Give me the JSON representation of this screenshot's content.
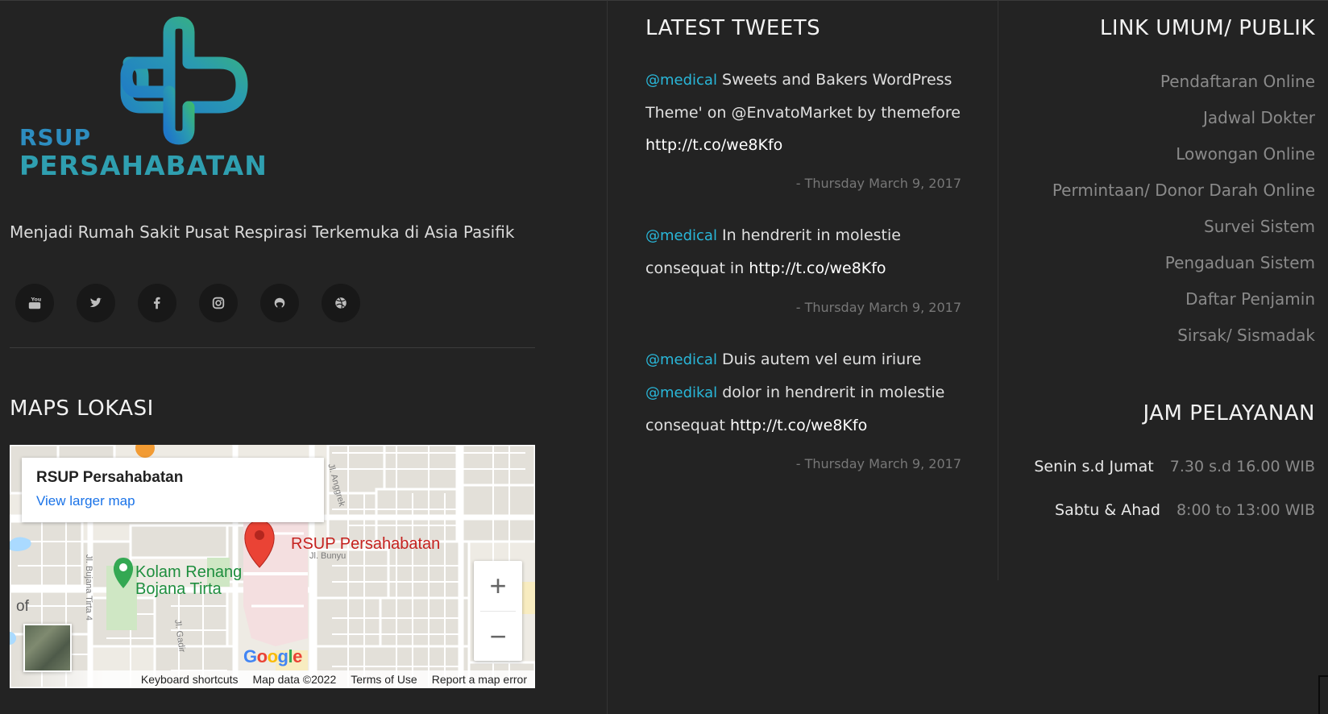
{
  "brand": {
    "logo_line1": "RSUP",
    "logo_line2": "PERSAHABATAN",
    "tagline": "Menjadi Rumah Sakit Pusat Respirasi Terkemuka di Asia Pasifik"
  },
  "socials": [
    {
      "icon": "youtube-icon"
    },
    {
      "icon": "twitter-icon"
    },
    {
      "icon": "facebook-icon"
    },
    {
      "icon": "instagram-icon"
    },
    {
      "icon": "github-icon"
    },
    {
      "icon": "dribbble-icon"
    }
  ],
  "maps": {
    "title": "MAPS LOKASI",
    "card_title": "RSUP Persahabatan",
    "card_link": "View larger map",
    "pin_label": "RSUP Persahabatan",
    "poi_label_1": "Kolam Renang",
    "poi_label_2": "Bojana Tirta",
    "street_1": "Jl. Anggrek",
    "street_2": "Jl. Bunyu",
    "street_3": "Jl. Bujana Tirta 4",
    "street_4": "Jl. Gadir",
    "edge_text": "of",
    "google": "Google",
    "zoom_in": "+",
    "zoom_out": "−",
    "attribution": {
      "shortcuts": "Keyboard shortcuts",
      "data": "Map data ©2022",
      "terms": "Terms of Use",
      "report": "Report a map error"
    }
  },
  "tweets": {
    "title": "LATEST TWEETS",
    "items": [
      {
        "handle": "@medical",
        "text": " Sweets and Bakers WordPress Theme' on @EnvatoMarket by themefore ",
        "link": "http://t.co/we8Kfo",
        "date": "- Thursday March 9, 2017"
      },
      {
        "handle": "@medical",
        "text": " In hendrerit in molestie consequat in ",
        "link": "http://t.co/we8Kfo",
        "date": "- Thursday March 9, 2017"
      },
      {
        "handle": "@medical",
        "text": " Duis autem vel eum iriure ",
        "handle2": "@medikal",
        "text2": " dolor in hendrerit in molestie consequat ",
        "link": "http://t.co/we8Kfo",
        "date": "- Thursday March 9, 2017"
      }
    ]
  },
  "links": {
    "title": "LINK UMUM/ PUBLIK",
    "items": [
      "Pendaftaran Online",
      "Jadwal Dokter",
      "Lowongan Online",
      "Permintaan/ Donor Darah Online",
      "Survei Sistem",
      "Pengaduan Sistem",
      "Daftar Penjamin",
      "Sirsak/ Sismadak"
    ]
  },
  "hours": {
    "title": "JAM PELAYANAN",
    "rows": [
      {
        "day": "Senin s.d Jumat",
        "time": "7.30 s.d 16.00 WIB"
      },
      {
        "day": "Sabtu & Ahad",
        "time": "8:00 to 13:00 WIB"
      }
    ]
  }
}
